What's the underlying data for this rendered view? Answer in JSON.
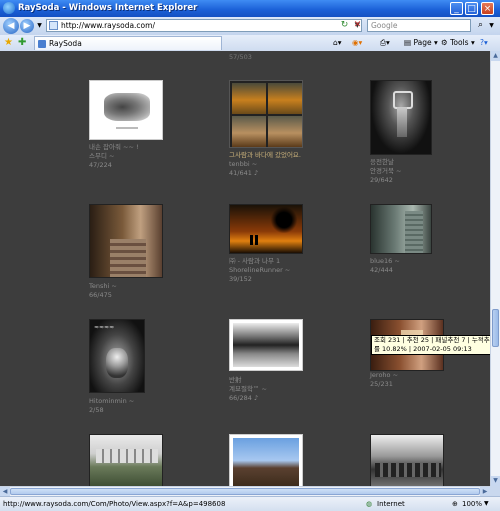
{
  "window": {
    "title": "RaySoda - Windows Internet Explorer"
  },
  "addressbar": {
    "url": "http://www.raysoda.com/",
    "search_placeholder": "Google"
  },
  "tab": {
    "label": "RaySoda"
  },
  "commandbar": {
    "page_label": "Page",
    "tools_label": "Tools"
  },
  "gallery": {
    "top_count": "57/503",
    "items": [
      {
        "title": "내손 잡아줘 ~~ !",
        "author": "스무디 ~",
        "stats": "47/224",
        "title_highlight": false
      },
      {
        "title": "그사람과 바다에 갔었어요.",
        "author": "tenbbi ~",
        "stats": "41/641  ♪",
        "title_highlight": true
      },
      {
        "title": "응전한날",
        "author": "안경거북 ~",
        "stats": "29/642",
        "title_highlight": false
      },
      {
        "title": "Tenshi ~",
        "author": "66/475",
        "stats": "",
        "title_highlight": false
      },
      {
        "title": "㈜ - 사람과 나무 1",
        "author": "ShorelineRunner ~",
        "stats": "39/152",
        "title_highlight": false
      },
      {
        "title": "blue16 ~",
        "author": "42/444",
        "stats": "",
        "title_highlight": false
      },
      {
        "title": "Hitominmin ~",
        "author": "2/58",
        "stats": "",
        "title_highlight": false
      },
      {
        "title": "반射",
        "author": "계묘절학™ ~",
        "stats": "66/284  ♪",
        "title_highlight": false
      },
      {
        "title": "Jeroho ~",
        "author": "25/231",
        "stats": "",
        "title_highlight": false
      }
    ]
  },
  "tooltip": {
    "line1": "조회 231 | 추천 25 | 패널추천 7 | 누적추천",
    "line2": "률 10.82% | 2007-02-05 09:13"
  },
  "statusbar": {
    "url": "http://www.raysoda.com/Com/Photo/View.aspx?f=A&p=498608",
    "zone": "Internet",
    "zoom": "100%"
  }
}
